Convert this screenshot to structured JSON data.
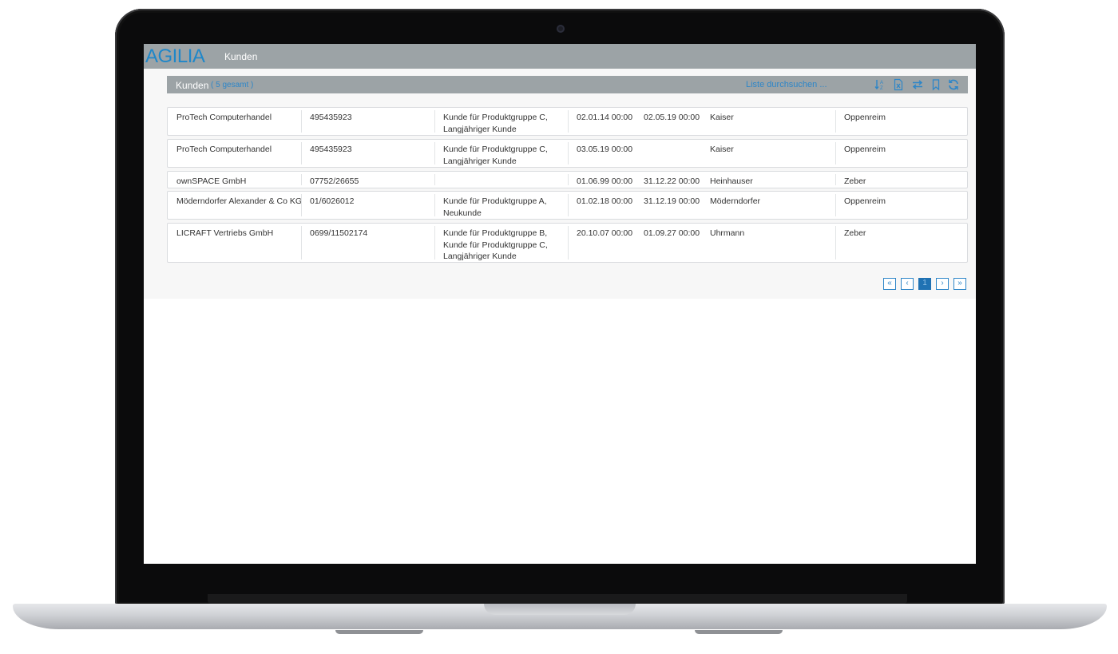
{
  "app": {
    "logo_text": "AGILIA",
    "title": "Kunden"
  },
  "panel": {
    "title": "Kunden",
    "count": "( 5 gesamt )",
    "search_placeholder": "Liste durchsuchen ...",
    "tools": [
      "sort-icon",
      "excel-export-icon",
      "swap-icon",
      "bookmark-icon",
      "refresh-icon"
    ]
  },
  "rows": [
    {
      "name": "ProTech Computerhandel",
      "number": "495435923",
      "groups": [
        "Kunde für Produktgruppe C,",
        "Langjähriger Kunde"
      ],
      "date_from": "02.01.14 00:00",
      "date_to": "02.05.19 00:00",
      "contact": "Kaiser",
      "city": "Oppenreim"
    },
    {
      "name": "ProTech Computerhandel",
      "number": "495435923",
      "groups": [
        "Kunde für Produktgruppe C,",
        "Langjähriger Kunde"
      ],
      "date_from": "03.05.19 00:00",
      "date_to": "",
      "contact": "Kaiser",
      "city": "Oppenreim"
    },
    {
      "name": "ownSPACE GmbH",
      "number": "07752/26655",
      "groups": [],
      "date_from": "01.06.99 00:00",
      "date_to": "31.12.22 00:00",
      "contact": "Heinhauser",
      "city": "Zeber"
    },
    {
      "name": "Möderndorfer Alexander & Co KG",
      "number": "01/6026012",
      "groups": [
        "Kunde für Produktgruppe A,",
        "Neukunde"
      ],
      "date_from": "01.02.18 00:00",
      "date_to": "31.12.19 00:00",
      "contact": "Möderndorfer",
      "city": "Oppenreim"
    },
    {
      "name": "LICRAFT Vertriebs GmbH",
      "number": "0699/11502174",
      "groups": [
        "Kunde für Produktgruppe B,",
        "Kunde für Produktgruppe C,",
        "Langjähriger Kunde"
      ],
      "date_from": "20.10.07 00:00",
      "date_to": "01.09.27 00:00",
      "contact": "Uhrmann",
      "city": "Zeber"
    }
  ],
  "pagination": {
    "first": "«",
    "prev": "‹",
    "current": "1",
    "next": "›",
    "last": "»"
  },
  "colors": {
    "accent": "#2e86c8",
    "header_bar": "#9ca3a6",
    "active_page": "#2072b3"
  }
}
